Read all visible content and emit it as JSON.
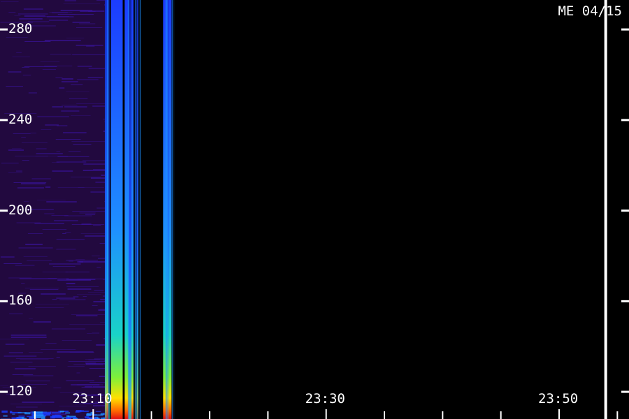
{
  "chart_data": {
    "type": "heatmap",
    "title": "",
    "station_label": "ME 04/15",
    "xlabel": "",
    "ylabel": "",
    "y_ticks": [
      {
        "value": 280,
        "label": "280"
      },
      {
        "value": 240,
        "label": "240"
      },
      {
        "value": 200,
        "label": "200"
      },
      {
        "value": 160,
        "label": "160"
      },
      {
        "value": 120,
        "label": "120"
      }
    ],
    "x_ticks": [
      {
        "value": "23:10",
        "label": "23:10"
      },
      {
        "value": "23:30",
        "label": "23:30"
      },
      {
        "value": "23:50",
        "label": "23:50"
      }
    ],
    "xlim": [
      "23:02",
      "23:56"
    ],
    "ylim": [
      108,
      293
    ],
    "colormap": [
      "#2a0d55",
      "#3a14a0",
      "#1c3cff",
      "#1e90ff",
      "#19d3c8",
      "#7df03a",
      "#ffe000",
      "#ff6a00",
      "#e01010"
    ],
    "background_color": "#000000",
    "marker_line_time": "23:54",
    "data_end_time": "23:20",
    "bursts": [
      {
        "start": "23:11",
        "end": "23:14",
        "intensity": "high"
      },
      {
        "start": "23:16",
        "end": "23:17",
        "intensity": "high"
      }
    ]
  }
}
